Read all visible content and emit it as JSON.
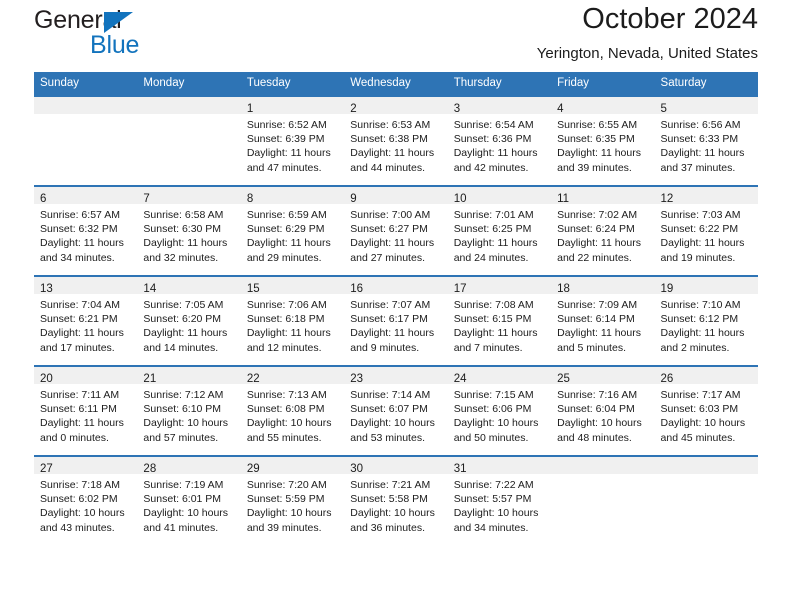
{
  "brand": {
    "name_top": "General",
    "name_bottom": "Blue",
    "color_primary": "#1273bd"
  },
  "header": {
    "title": "October 2024",
    "subtitle": "Yerington, Nevada, United States",
    "header_bg": "#2e74b5",
    "daynum_bg": "#f0f0f0"
  },
  "calendar": {
    "weekday_headers": [
      "Sunday",
      "Monday",
      "Tuesday",
      "Wednesday",
      "Thursday",
      "Friday",
      "Saturday"
    ],
    "weeks": [
      [
        {
          "day": "",
          "empty": true
        },
        {
          "day": "",
          "empty": true
        },
        {
          "day": "1",
          "sunrise": "Sunrise: 6:52 AM",
          "sunset": "Sunset: 6:39 PM",
          "daylight": "Daylight: 11 hours and 47 minutes."
        },
        {
          "day": "2",
          "sunrise": "Sunrise: 6:53 AM",
          "sunset": "Sunset: 6:38 PM",
          "daylight": "Daylight: 11 hours and 44 minutes."
        },
        {
          "day": "3",
          "sunrise": "Sunrise: 6:54 AM",
          "sunset": "Sunset: 6:36 PM",
          "daylight": "Daylight: 11 hours and 42 minutes."
        },
        {
          "day": "4",
          "sunrise": "Sunrise: 6:55 AM",
          "sunset": "Sunset: 6:35 PM",
          "daylight": "Daylight: 11 hours and 39 minutes."
        },
        {
          "day": "5",
          "sunrise": "Sunrise: 6:56 AM",
          "sunset": "Sunset: 6:33 PM",
          "daylight": "Daylight: 11 hours and 37 minutes."
        }
      ],
      [
        {
          "day": "6",
          "sunrise": "Sunrise: 6:57 AM",
          "sunset": "Sunset: 6:32 PM",
          "daylight": "Daylight: 11 hours and 34 minutes."
        },
        {
          "day": "7",
          "sunrise": "Sunrise: 6:58 AM",
          "sunset": "Sunset: 6:30 PM",
          "daylight": "Daylight: 11 hours and 32 minutes."
        },
        {
          "day": "8",
          "sunrise": "Sunrise: 6:59 AM",
          "sunset": "Sunset: 6:29 PM",
          "daylight": "Daylight: 11 hours and 29 minutes."
        },
        {
          "day": "9",
          "sunrise": "Sunrise: 7:00 AM",
          "sunset": "Sunset: 6:27 PM",
          "daylight": "Daylight: 11 hours and 27 minutes."
        },
        {
          "day": "10",
          "sunrise": "Sunrise: 7:01 AM",
          "sunset": "Sunset: 6:25 PM",
          "daylight": "Daylight: 11 hours and 24 minutes."
        },
        {
          "day": "11",
          "sunrise": "Sunrise: 7:02 AM",
          "sunset": "Sunset: 6:24 PM",
          "daylight": "Daylight: 11 hours and 22 minutes."
        },
        {
          "day": "12",
          "sunrise": "Sunrise: 7:03 AM",
          "sunset": "Sunset: 6:22 PM",
          "daylight": "Daylight: 11 hours and 19 minutes."
        }
      ],
      [
        {
          "day": "13",
          "sunrise": "Sunrise: 7:04 AM",
          "sunset": "Sunset: 6:21 PM",
          "daylight": "Daylight: 11 hours and 17 minutes."
        },
        {
          "day": "14",
          "sunrise": "Sunrise: 7:05 AM",
          "sunset": "Sunset: 6:20 PM",
          "daylight": "Daylight: 11 hours and 14 minutes."
        },
        {
          "day": "15",
          "sunrise": "Sunrise: 7:06 AM",
          "sunset": "Sunset: 6:18 PM",
          "daylight": "Daylight: 11 hours and 12 minutes."
        },
        {
          "day": "16",
          "sunrise": "Sunrise: 7:07 AM",
          "sunset": "Sunset: 6:17 PM",
          "daylight": "Daylight: 11 hours and 9 minutes."
        },
        {
          "day": "17",
          "sunrise": "Sunrise: 7:08 AM",
          "sunset": "Sunset: 6:15 PM",
          "daylight": "Daylight: 11 hours and 7 minutes."
        },
        {
          "day": "18",
          "sunrise": "Sunrise: 7:09 AM",
          "sunset": "Sunset: 6:14 PM",
          "daylight": "Daylight: 11 hours and 5 minutes."
        },
        {
          "day": "19",
          "sunrise": "Sunrise: 7:10 AM",
          "sunset": "Sunset: 6:12 PM",
          "daylight": "Daylight: 11 hours and 2 minutes."
        }
      ],
      [
        {
          "day": "20",
          "sunrise": "Sunrise: 7:11 AM",
          "sunset": "Sunset: 6:11 PM",
          "daylight": "Daylight: 11 hours and 0 minutes."
        },
        {
          "day": "21",
          "sunrise": "Sunrise: 7:12 AM",
          "sunset": "Sunset: 6:10 PM",
          "daylight": "Daylight: 10 hours and 57 minutes."
        },
        {
          "day": "22",
          "sunrise": "Sunrise: 7:13 AM",
          "sunset": "Sunset: 6:08 PM",
          "daylight": "Daylight: 10 hours and 55 minutes."
        },
        {
          "day": "23",
          "sunrise": "Sunrise: 7:14 AM",
          "sunset": "Sunset: 6:07 PM",
          "daylight": "Daylight: 10 hours and 53 minutes."
        },
        {
          "day": "24",
          "sunrise": "Sunrise: 7:15 AM",
          "sunset": "Sunset: 6:06 PM",
          "daylight": "Daylight: 10 hours and 50 minutes."
        },
        {
          "day": "25",
          "sunrise": "Sunrise: 7:16 AM",
          "sunset": "Sunset: 6:04 PM",
          "daylight": "Daylight: 10 hours and 48 minutes."
        },
        {
          "day": "26",
          "sunrise": "Sunrise: 7:17 AM",
          "sunset": "Sunset: 6:03 PM",
          "daylight": "Daylight: 10 hours and 45 minutes."
        }
      ],
      [
        {
          "day": "27",
          "sunrise": "Sunrise: 7:18 AM",
          "sunset": "Sunset: 6:02 PM",
          "daylight": "Daylight: 10 hours and 43 minutes."
        },
        {
          "day": "28",
          "sunrise": "Sunrise: 7:19 AM",
          "sunset": "Sunset: 6:01 PM",
          "daylight": "Daylight: 10 hours and 41 minutes."
        },
        {
          "day": "29",
          "sunrise": "Sunrise: 7:20 AM",
          "sunset": "Sunset: 5:59 PM",
          "daylight": "Daylight: 10 hours and 39 minutes."
        },
        {
          "day": "30",
          "sunrise": "Sunrise: 7:21 AM",
          "sunset": "Sunset: 5:58 PM",
          "daylight": "Daylight: 10 hours and 36 minutes."
        },
        {
          "day": "31",
          "sunrise": "Sunrise: 7:22 AM",
          "sunset": "Sunset: 5:57 PM",
          "daylight": "Daylight: 10 hours and 34 minutes."
        },
        {
          "day": "",
          "empty": true
        },
        {
          "day": "",
          "empty": true
        }
      ]
    ]
  }
}
